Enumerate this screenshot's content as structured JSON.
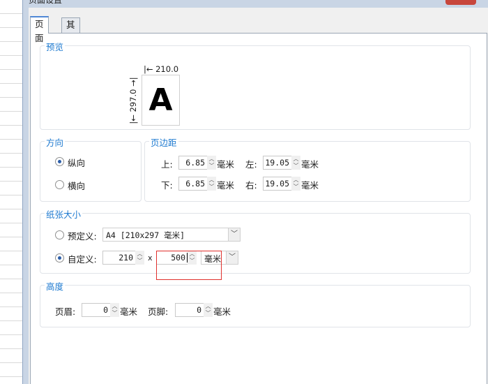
{
  "window": {
    "title": "页面设置",
    "close_icon": "close-x-icon"
  },
  "tabs": [
    {
      "label": "页面",
      "active": true
    },
    {
      "label": "其他",
      "active": false
    }
  ],
  "preview": {
    "title": "预览",
    "paper_letter": "A",
    "width_label": "|← 210.0 →|",
    "height_label": "|← 297.0 →|"
  },
  "orientation": {
    "title": "方向",
    "options": [
      {
        "label": "纵向",
        "checked": true
      },
      {
        "label": "横向",
        "checked": false
      }
    ]
  },
  "margins": {
    "title": "页边距",
    "top_label": "上:",
    "top_value": "6.85",
    "left_label": "左:",
    "left_value": "19.05",
    "bottom_label": "下:",
    "bottom_value": "6.85",
    "right_label": "右:",
    "right_value": "19.05",
    "unit": "毫米"
  },
  "paper_size": {
    "title": "纸张大小",
    "predefined_label": "预定义:",
    "predefined_value": "A4 [210x297 毫米]",
    "custom_label": "自定义:",
    "custom_width": "210",
    "times": "x",
    "custom_height": "500",
    "unit_value": "毫米",
    "selected": "custom"
  },
  "height": {
    "title": "高度",
    "header_label": "页眉:",
    "header_value": "0",
    "footer_label": "页脚:",
    "footer_value": "0",
    "unit": "毫米"
  },
  "colors": {
    "accent": "#1e7ad0",
    "highlight": "#e0302c",
    "close": "#c7463c"
  }
}
